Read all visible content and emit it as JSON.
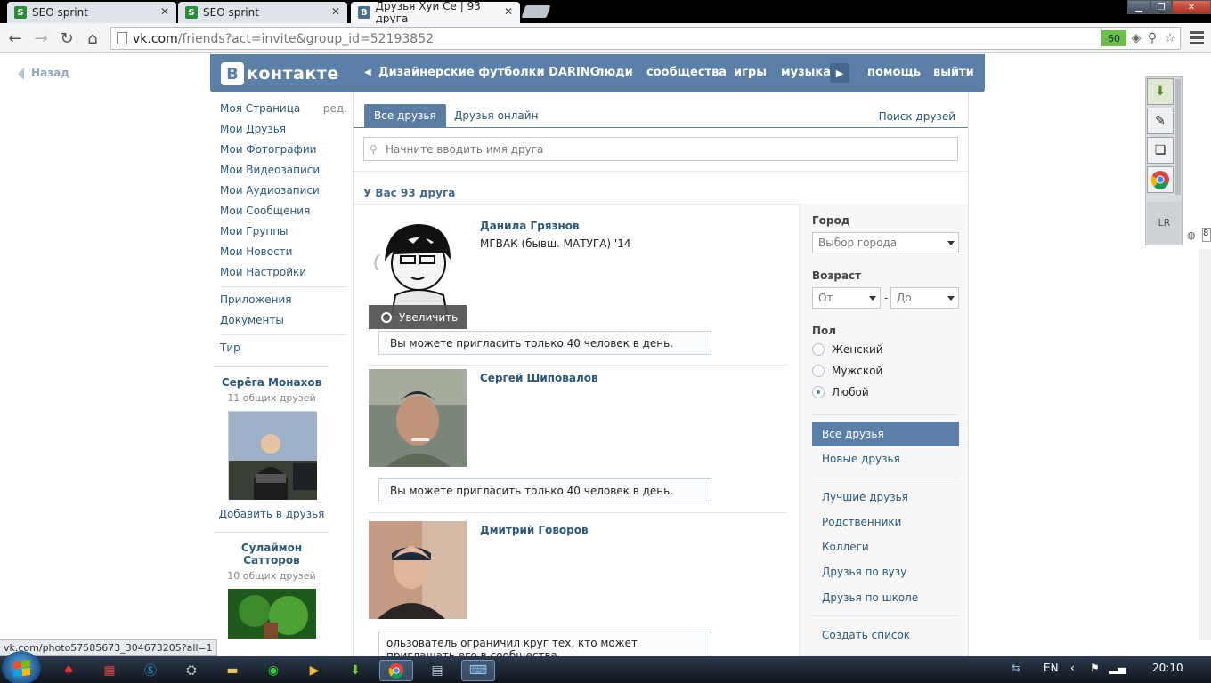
{
  "browser": {
    "tabs": [
      {
        "title": "SEO sprint",
        "favicon": "S"
      },
      {
        "title": "SEO sprint",
        "favicon": "S"
      },
      {
        "title": "Друзья Хуи Се | 93 друга",
        "favicon": "B"
      }
    ],
    "url_host": "vk.com",
    "url_path": "/friends?act=invite&group_id=52193852",
    "badge_count": "60",
    "status_url": "vk.com/photo57585673_304673205?all=1"
  },
  "header": {
    "logo_letter": "B",
    "logo_text": "контакте",
    "group_link": "Дизайнерские футболки DARING...",
    "nav": [
      "люди",
      "сообщества",
      "игры",
      "музыка",
      "помощь",
      "выйти"
    ],
    "accent_color": "#5b7fa6"
  },
  "back_label": "Назад",
  "left_menu": {
    "edit_label": "ред.",
    "main": [
      "Моя Страница",
      "Мои Друзья",
      "Мои Фотографии",
      "Мои Видеозаписи",
      "Мои Аудиозаписи",
      "Мои Сообщения",
      "Мои Группы",
      "Мои Новости",
      "Мои Настройки"
    ],
    "apps": [
      "Приложения",
      "Документы"
    ],
    "extra": [
      "Тир"
    ]
  },
  "suggestions": [
    {
      "name": "Серёга Монахов",
      "mutual": "11 общих друзей",
      "add": "Добавить в друзья"
    },
    {
      "name": "Сулаймон Сатторов",
      "mutual": "10 общих друзей"
    }
  ],
  "main": {
    "tabs": [
      "Все друзья",
      "Друзья онлайн"
    ],
    "find_friends": "Поиск друзей",
    "search_placeholder": "Начните вводить имя друга",
    "count_label": "У Вас 93 друга",
    "zoom_label": "Увеличить",
    "friends": [
      {
        "name": "Данила Грязнов",
        "subtitle": "МГВАК (бывш. МАТУГА) '14",
        "notice": "Вы можете пригласить только 40 человек в день."
      },
      {
        "name": "Сергей Шиповалов",
        "subtitle": "",
        "notice": "Вы можете пригласить только 40 человек в день."
      },
      {
        "name": "Дмитрий Говоров",
        "subtitle": "",
        "notice": "ользователь ограничил круг тех, кто может приглашать его в сообщества."
      }
    ]
  },
  "filters": {
    "city_label": "Город",
    "city_value": "Выбор города",
    "age_label": "Возраст",
    "age_from": "От",
    "age_dash": "-",
    "age_to": "До",
    "sex_label": "Пол",
    "sex_options": [
      "Женский",
      "Мужской",
      "Любой"
    ],
    "sex_selected": 2,
    "lists_top": [
      "Все друзья",
      "Новые друзья"
    ],
    "lists": [
      "Лучшие друзья",
      "Родственники",
      "Коллеги",
      "Друзья по вузу",
      "Друзья по школе"
    ],
    "create_list": "Создать список"
  },
  "extension": {
    "lr_label": "LR",
    "side_value": "8"
  },
  "taskbar": {
    "lang": "EN",
    "time": "20:10",
    "icons": [
      "chrome-icon",
      "skype-icon",
      "folder-icon",
      "media-icon",
      "download-icon",
      "notepad-icon",
      "keyboard-icon"
    ]
  }
}
